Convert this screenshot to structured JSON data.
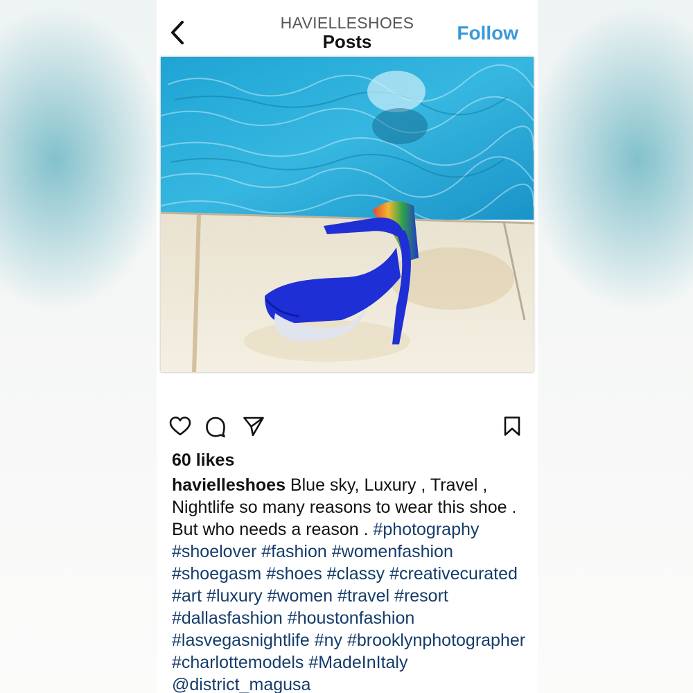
{
  "header": {
    "username": "HAVIELLESHOES",
    "title": "Posts",
    "follow_label": "Follow"
  },
  "icons": {
    "back": "chevron-left-icon",
    "like": "heart-icon",
    "comment": "comment-icon",
    "share": "paper-plane-icon",
    "save": "bookmark-icon"
  },
  "colors": {
    "follow": "#3a98d8",
    "hashtag": "#153c69",
    "shoe": "#1f2fd6",
    "pool_water": "#2aa9d6"
  },
  "post": {
    "likes": "60 likes",
    "caption_user": "havielleshoes",
    "caption_text": " Blue sky, Luxury , Travel , Nightlife so many reasons to wear this shoe . But who needs a reason . ",
    "hashtags": [
      "#photography",
      "#shoelover",
      "#fashion",
      "#womenfashion",
      "#shoegasm",
      "#shoes",
      "#classy",
      "#creativecurated",
      "#art",
      "#luxury",
      "#women",
      "#travel",
      "#resort",
      "#dallasfashion",
      "#houstonfashion",
      "#lasvegasnightlife",
      "#ny",
      "#brooklynphotographer",
      "#charlottemodels",
      "#MadeInItaly",
      "@district_magusa"
    ]
  }
}
